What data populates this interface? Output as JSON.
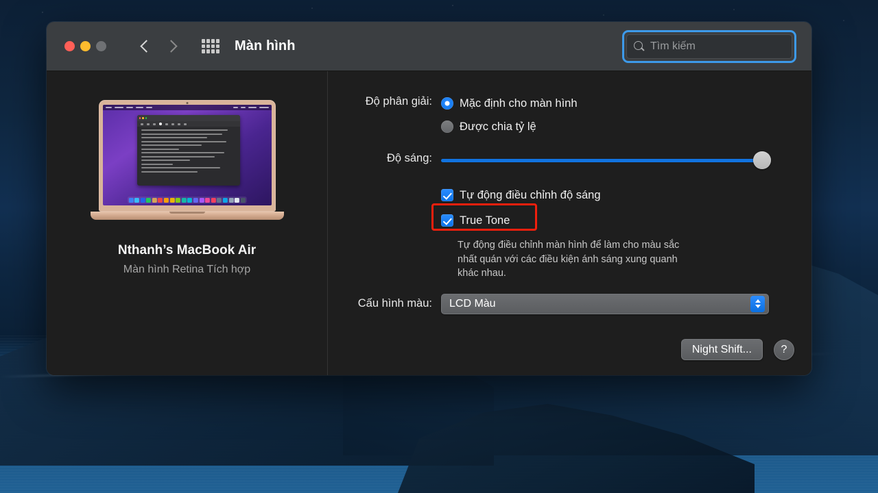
{
  "window": {
    "title": "Màn hình",
    "traffic_lights": [
      "close",
      "minimize",
      "zoom"
    ],
    "back_icon": "chevron-left-icon",
    "forward_icon": "chevron-right-icon",
    "grid_icon": "grid-view-icon"
  },
  "search": {
    "placeholder": "Tìm kiếm",
    "value": "",
    "icon": "search-icon",
    "focus_ring_color": "#3d9aea"
  },
  "device": {
    "name": "Nthanh’s MacBook Air",
    "subtitle": "Màn hình Retina Tích hợp",
    "illustration": "macbook-air-gold"
  },
  "resolution": {
    "label": "Độ phân giải:",
    "options": [
      {
        "label": "Mặc định cho màn hình",
        "selected": true
      },
      {
        "label": "Được chia tỷ lệ",
        "selected": false
      }
    ]
  },
  "brightness": {
    "label": "Độ sáng:",
    "value_percent": 100
  },
  "checkboxes": [
    {
      "label": "Tự động điều chỉnh độ sáng",
      "checked": true
    },
    {
      "label": "True Tone",
      "checked": true
    }
  ],
  "true_tone": {
    "description": "Tự động điều chỉnh màn hình để làm cho màu sắc nhất quán với các điều kiện ánh sáng xung quanh khác nhau.",
    "highlight_color": "#f01f0d"
  },
  "color_profile": {
    "label": "Cấu hình màu:",
    "value": "LCD Màu",
    "stepper_icon": "chevron-up-down-icon"
  },
  "footer": {
    "night_shift_label": "Night Shift...",
    "help_label": "?"
  },
  "colors": {
    "accent": "#0a72e8",
    "titlebar": "#3b3e41",
    "window_body": "#1e1e1e",
    "slider_fill": "#1173e0"
  }
}
